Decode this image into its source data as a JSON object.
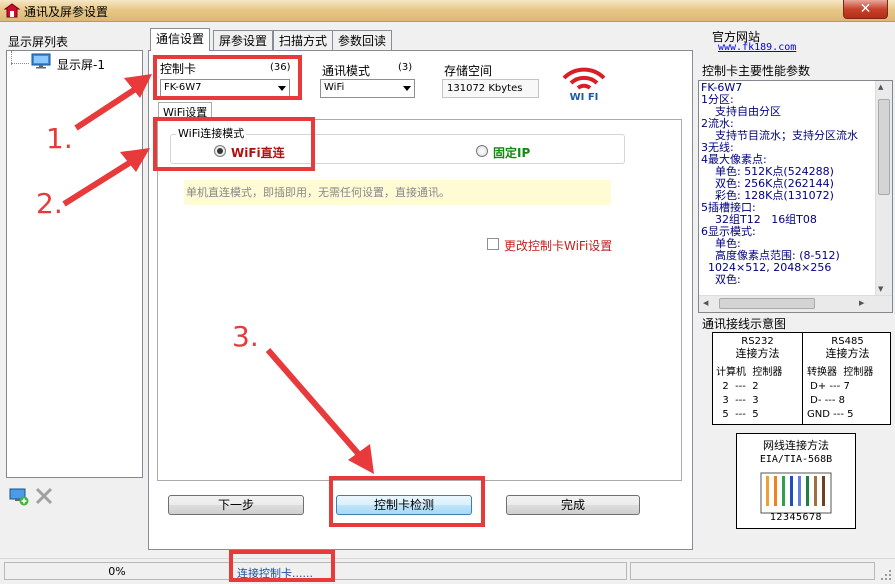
{
  "window": {
    "title": "通讯及屏参设置",
    "close_label": "✕"
  },
  "left_panel": {
    "label": "显示屏列表",
    "tree_item": "显示屏-1"
  },
  "tabs": [
    {
      "label": "通信设置",
      "active": true
    },
    {
      "label": "屏参设置",
      "active": false
    },
    {
      "label": "扫描方式",
      "active": false
    },
    {
      "label": "参数回读",
      "active": false
    }
  ],
  "comm": {
    "card_label": "控制卡",
    "card_count": "(36)",
    "card_value": "FK-6W7",
    "mode_label": "通讯模式",
    "mode_count": "(3)",
    "mode_value": "WiFi",
    "storage_label": "存储空间",
    "storage_value": "131072 Kbytes",
    "wifi_logo_text": "WI FI"
  },
  "wifi": {
    "tab_label": "WiFi设置",
    "group_label": "WiFi连接模式",
    "option_direct": "WiFi直连",
    "option_fixed_ip": "固定IP",
    "hint": "单机直连模式，即插即用，无需任何设置，直接通讯。",
    "change_checkbox": "更改控制卡WiFi设置"
  },
  "buttons": {
    "next": "下一步",
    "detect": "控制卡检测",
    "finish": "完成"
  },
  "right_panel": {
    "official_label": "官方网站",
    "official_link": "www.fk189.com",
    "params_title": "控制卡主要性能参数",
    "params_lines": "FK-6W7\n1分区:\n    支持自由分区\n2流水:\n    支持节目流水；支持分区流水\n3无线:\n4最大像素点:\n    单色: 512K点(524288)\n    双色: 256K点(262144)\n    彩色: 128K点(131072)\n5插槽接口:\n    32组T12   16组T08\n6显示模式:\n    单色:\n    高度像素点范围: (8-512)\n  1024×512, 2048×256\n    双色:",
    "wiring_title": "通讯接线示意图",
    "rs232_title": "RS232",
    "rs232_sub": "连接方法",
    "rs485_title": "RS485",
    "rs485_sub": "连接方法",
    "rs232_rows": "计算机  控制器\n  2  ---  2\n  3  ---  3\n  5  ---  5",
    "rs485_rows": "转换器  控制器\n D+ --- 7\n D- --- 8\nGND --- 5",
    "net_title": "网线连接方法",
    "net_sub": "EIA/TIA-568B",
    "net_pins": "12345678"
  },
  "statusbar": {
    "progress": "0%",
    "progress_value": 0,
    "message": "连接控制卡......"
  },
  "annotations": {
    "n1": "1.",
    "n2": "2.",
    "n3": "3.",
    "color": "#e83a3a"
  }
}
